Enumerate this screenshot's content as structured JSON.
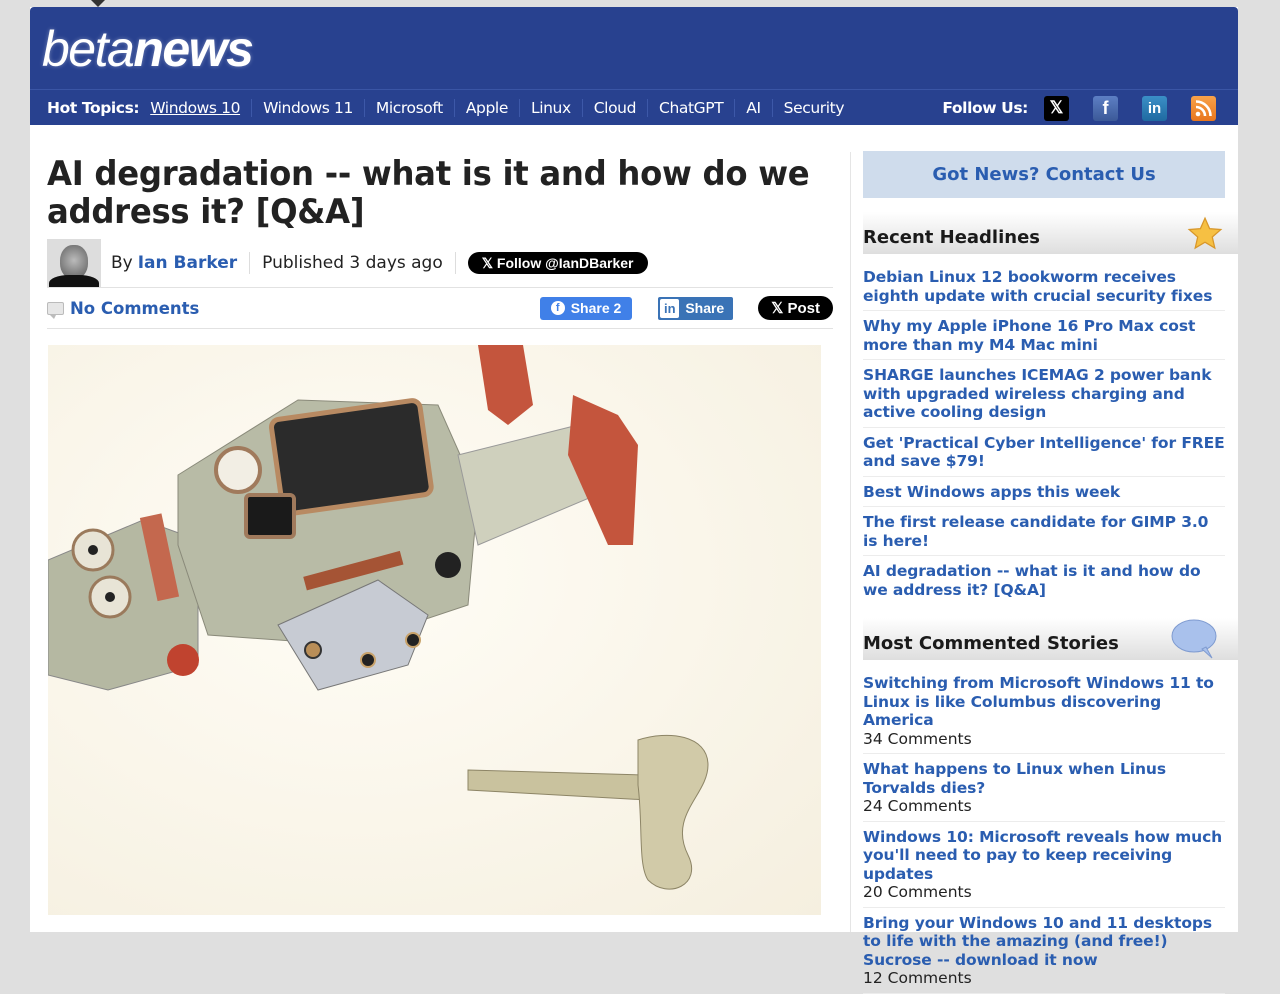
{
  "site": {
    "logo_light": "beta",
    "logo_bold": "news"
  },
  "nav": {
    "label": "Hot Topics:",
    "items": [
      "Windows 10",
      "Windows 11",
      "Microsoft",
      "Apple",
      "Linux",
      "Cloud",
      "ChatGPT",
      "AI",
      "Security"
    ],
    "follow_label": "Follow Us:",
    "social": [
      {
        "icon": "x-icon",
        "glyph": "𝕏"
      },
      {
        "icon": "facebook-icon",
        "glyph": "f"
      },
      {
        "icon": "linkedin-icon",
        "glyph": "in"
      },
      {
        "icon": "rss-icon",
        "glyph": ""
      }
    ]
  },
  "article": {
    "title": "AI degradation -- what is it and how do we address it? [Q&A]",
    "by": "By",
    "author": "Ian Barker",
    "published": "Published 3 days ago",
    "follow_button": "𝕏 Follow @IanDBarker",
    "comments": "No Comments",
    "share": {
      "facebook": "Share 2",
      "linkedin": "Share",
      "x_post": "𝕏 Post"
    },
    "image_alt": "Broken wind-up tin toy robot lying on its side next to its winding key"
  },
  "sidebar": {
    "contact": "Got News? Contact Us",
    "recent": {
      "title": "Recent Headlines",
      "items": [
        "Debian Linux 12 bookworm receives eighth update with crucial security fixes",
        "Why my Apple iPhone 16 Pro Max cost more than my M4 Mac mini",
        "SHARGE launches ICEMAG 2 power bank with upgraded wireless charging and active cooling design",
        "Get 'Practical Cyber Intelligence' for FREE and save $79!",
        "Best Windows apps this week",
        "The first release candidate for GIMP 3.0 is here!",
        "AI degradation -- what is it and how do we address it? [Q&A]"
      ]
    },
    "commented": {
      "title": "Most Commented Stories",
      "items": [
        {
          "title": "Switching from Microsoft Windows 11 to Linux is like Columbus discovering America",
          "count": "34 Comments"
        },
        {
          "title": "What happens to Linux when Linus Torvalds dies?",
          "count": "24 Comments"
        },
        {
          "title": "Windows 10: Microsoft reveals how much you'll need to pay to keep receiving updates",
          "count": "20 Comments"
        },
        {
          "title": "Bring your Windows 10 and 11 desktops to life with the amazing (and free!) Sucrose -- download it now",
          "count": "12 Comments"
        }
      ]
    }
  }
}
